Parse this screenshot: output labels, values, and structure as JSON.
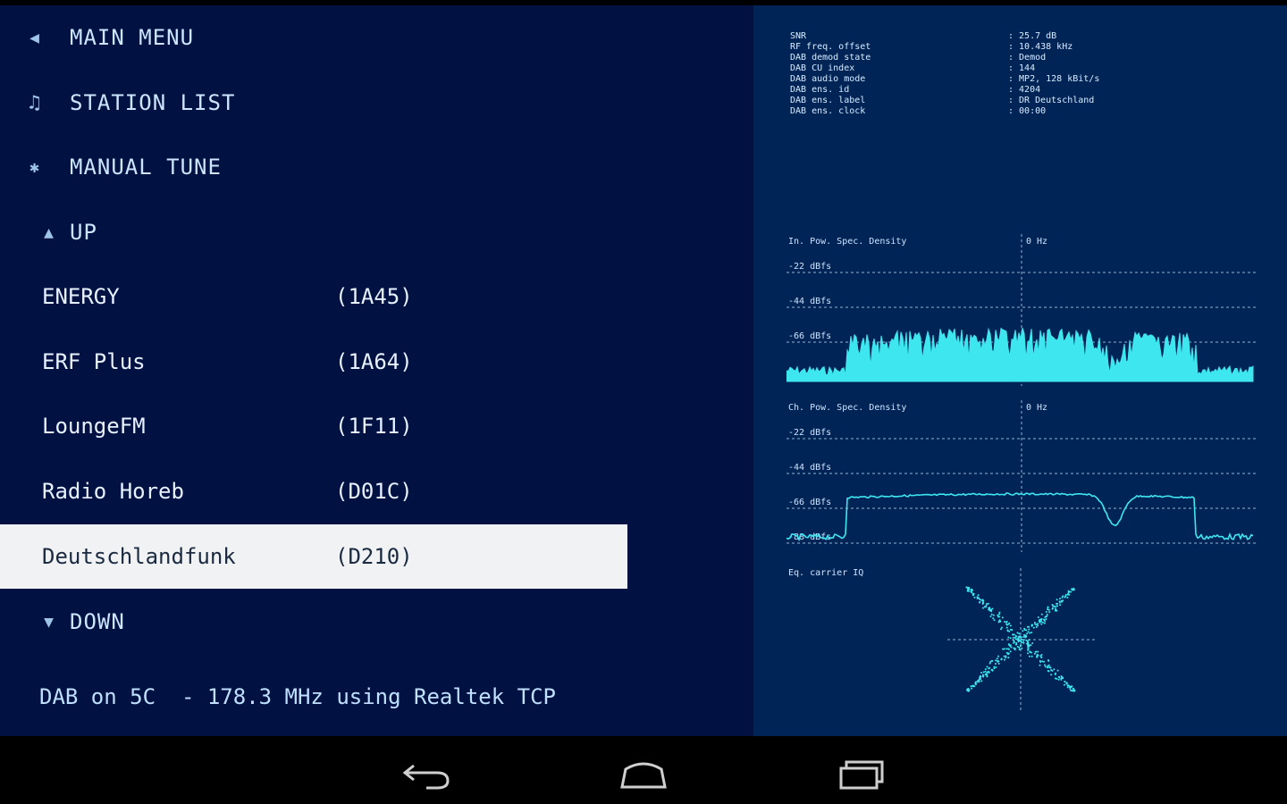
{
  "menu": {
    "main_menu": "MAIN MENU",
    "station_list": "STATION LIST",
    "manual_tune": "MANUAL TUNE",
    "up": "UP",
    "down": "DOWN"
  },
  "stations": [
    {
      "name": "ENERGY",
      "code": "(1A45)"
    },
    {
      "name": "ERF Plus",
      "code": "(1A64)"
    },
    {
      "name": "LoungeFM",
      "code": "(1F11)"
    },
    {
      "name": "Radio Horeb",
      "code": "(D01C)"
    },
    {
      "name": "Deutschlandfunk",
      "code": "(D210)",
      "selected": true
    }
  ],
  "status_line": "DAB on 5C  - 178.3 MHz using Realtek TCP",
  "info": {
    "keys": [
      "SNR",
      "RF freq. offset",
      "DAB demod state",
      "DAB CU index",
      "DAB audio mode",
      "DAB ens. id",
      "DAB ens. label",
      "DAB ens. clock"
    ],
    "values": [
      ": 25.7 dB",
      ": 10.438 kHz",
      ": Demod",
      ": 144",
      ": MP2, 128 kBit/s",
      ": 4204",
      ": DR Deutschland",
      ": 00:00"
    ]
  },
  "plot1": {
    "title": "In. Pow. Spec. Density",
    "center": "0 Hz",
    "grid_labels": [
      "-22 dBfs",
      "-44 dBfs",
      "-66 dBfs"
    ]
  },
  "plot2": {
    "title": "Ch. Pow. Spec. Density",
    "center": "0 Hz",
    "grid_labels": [
      "-22 dBfs",
      "-44 dBfs",
      "-66 dBfs",
      "-88 dBfs"
    ]
  },
  "plot3": {
    "title": "Eq. carrier IQ"
  },
  "colors": {
    "left_bg": "#001142",
    "right_bg": "#012456",
    "trace": "#3ee6f0",
    "selected_bg": "#f1f2f4"
  },
  "icons": {
    "back": "back-arrow-icon",
    "home": "home-icon",
    "recents": "recent-apps-icon"
  }
}
